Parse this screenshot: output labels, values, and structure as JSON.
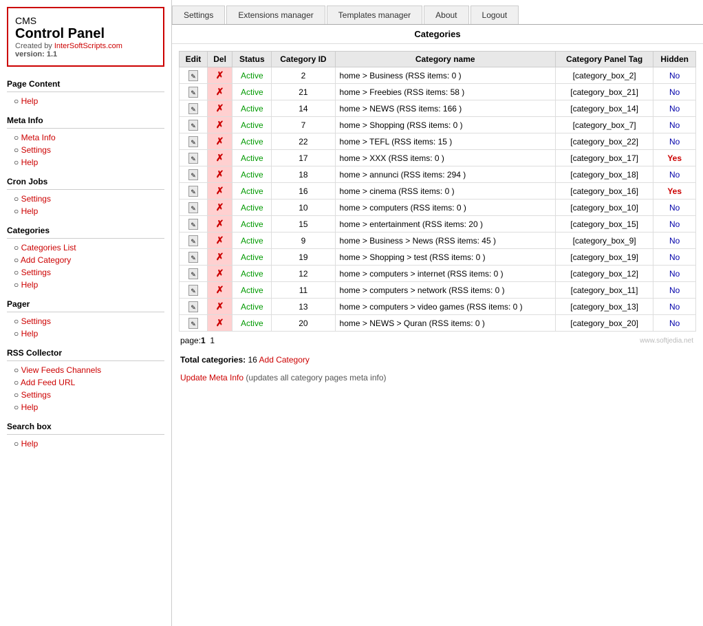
{
  "brand": {
    "title_sm": "CMS",
    "title_lg": "Control Panel",
    "created_by_text": "Created by ",
    "created_by_link": "InterSoftScripts.com",
    "version_label": "version:",
    "version": "1.1"
  },
  "sidebar": {
    "sections": [
      {
        "title": "Page Content",
        "items": [
          {
            "label": "Help",
            "href": "#"
          }
        ]
      },
      {
        "title": "Meta Info",
        "items": [
          {
            "label": "Meta Info",
            "href": "#"
          },
          {
            "label": "Settings",
            "href": "#"
          },
          {
            "label": "Help",
            "href": "#"
          }
        ]
      },
      {
        "title": "Cron Jobs",
        "items": [
          {
            "label": "Settings",
            "href": "#"
          },
          {
            "label": "Help",
            "href": "#"
          }
        ]
      },
      {
        "title": "Categories",
        "items": [
          {
            "label": "Categories List",
            "href": "#"
          },
          {
            "label": "Add Category",
            "href": "#"
          },
          {
            "label": "Settings",
            "href": "#"
          },
          {
            "label": "Help",
            "href": "#"
          }
        ]
      },
      {
        "title": "Pager",
        "items": [
          {
            "label": "Settings",
            "href": "#"
          },
          {
            "label": "Help",
            "href": "#"
          }
        ]
      },
      {
        "title": "RSS Collector",
        "items": [
          {
            "label": "View Feeds Channels",
            "href": "#"
          },
          {
            "label": "Add Feed URL",
            "href": "#"
          },
          {
            "label": "Settings",
            "href": "#"
          },
          {
            "label": "Help",
            "href": "#"
          }
        ]
      },
      {
        "title": "Search box",
        "items": [
          {
            "label": "Help",
            "href": "#"
          }
        ]
      }
    ]
  },
  "nav": {
    "items": [
      {
        "label": "Settings"
      },
      {
        "label": "Extensions manager"
      },
      {
        "label": "Templates manager"
      },
      {
        "label": "About"
      },
      {
        "label": "Logout"
      }
    ]
  },
  "page_title": "Categories",
  "table": {
    "headers": [
      "Edit",
      "Del",
      "Status",
      "Category ID",
      "Category name",
      "Category Panel Tag",
      "Hidden"
    ],
    "rows": [
      {
        "status": "Active",
        "cat_id": "2",
        "cat_name": "home > Business (RSS items: 0 )",
        "panel_tag": "[category_box_2]",
        "hidden": "No"
      },
      {
        "status": "Active",
        "cat_id": "21",
        "cat_name": "home > Freebies (RSS items: 58 )",
        "panel_tag": "[category_box_21]",
        "hidden": "No"
      },
      {
        "status": "Active",
        "cat_id": "14",
        "cat_name": "home > NEWS (RSS items: 166 )",
        "panel_tag": "[category_box_14]",
        "hidden": "No"
      },
      {
        "status": "Active",
        "cat_id": "7",
        "cat_name": "home > Shopping (RSS items: 0 )",
        "panel_tag": "[category_box_7]",
        "hidden": "No"
      },
      {
        "status": "Active",
        "cat_id": "22",
        "cat_name": "home > TEFL (RSS items: 15 )",
        "panel_tag": "[category_box_22]",
        "hidden": "No"
      },
      {
        "status": "Active",
        "cat_id": "17",
        "cat_name": "home > XXX (RSS items: 0 )",
        "panel_tag": "[category_box_17]",
        "hidden": "Yes"
      },
      {
        "status": "Active",
        "cat_id": "18",
        "cat_name": "home > annunci (RSS items: 294 )",
        "panel_tag": "[category_box_18]",
        "hidden": "No"
      },
      {
        "status": "Active",
        "cat_id": "16",
        "cat_name": "home > cinema (RSS items: 0 )",
        "panel_tag": "[category_box_16]",
        "hidden": "Yes"
      },
      {
        "status": "Active",
        "cat_id": "10",
        "cat_name": "home > computers (RSS items: 0 )",
        "panel_tag": "[category_box_10]",
        "hidden": "No"
      },
      {
        "status": "Active",
        "cat_id": "15",
        "cat_name": "home > entertainment (RSS items: 20 )",
        "panel_tag": "[category_box_15]",
        "hidden": "No"
      },
      {
        "status": "Active",
        "cat_id": "9",
        "cat_name": "home > Business > News (RSS items: 45 )",
        "panel_tag": "[category_box_9]",
        "hidden": "No"
      },
      {
        "status": "Active",
        "cat_id": "19",
        "cat_name": "home > Shopping > test (RSS items: 0 )",
        "panel_tag": "[category_box_19]",
        "hidden": "No"
      },
      {
        "status": "Active",
        "cat_id": "12",
        "cat_name": "home > computers > internet (RSS items: 0 )",
        "panel_tag": "[category_box_12]",
        "hidden": "No"
      },
      {
        "status": "Active",
        "cat_id": "11",
        "cat_name": "home > computers > network (RSS items: 0 )",
        "panel_tag": "[category_box_11]",
        "hidden": "No"
      },
      {
        "status": "Active",
        "cat_id": "13",
        "cat_name": "home > computers > video games (RSS items: 0 )",
        "panel_tag": "[category_box_13]",
        "hidden": "No"
      },
      {
        "status": "Active",
        "cat_id": "20",
        "cat_name": "home > NEWS > Quran (RSS items: 0 )",
        "panel_tag": "[category_box_20]",
        "hidden": "No"
      }
    ]
  },
  "pagination": {
    "label": "page:",
    "current": "1",
    "total": "1"
  },
  "watermark": "www.softjedia.net",
  "total_label": "Total categories:",
  "total_count": "16",
  "add_category_label": "Add Category",
  "update_label": "Update Meta Info",
  "update_desc": "(updates all category pages meta info)"
}
